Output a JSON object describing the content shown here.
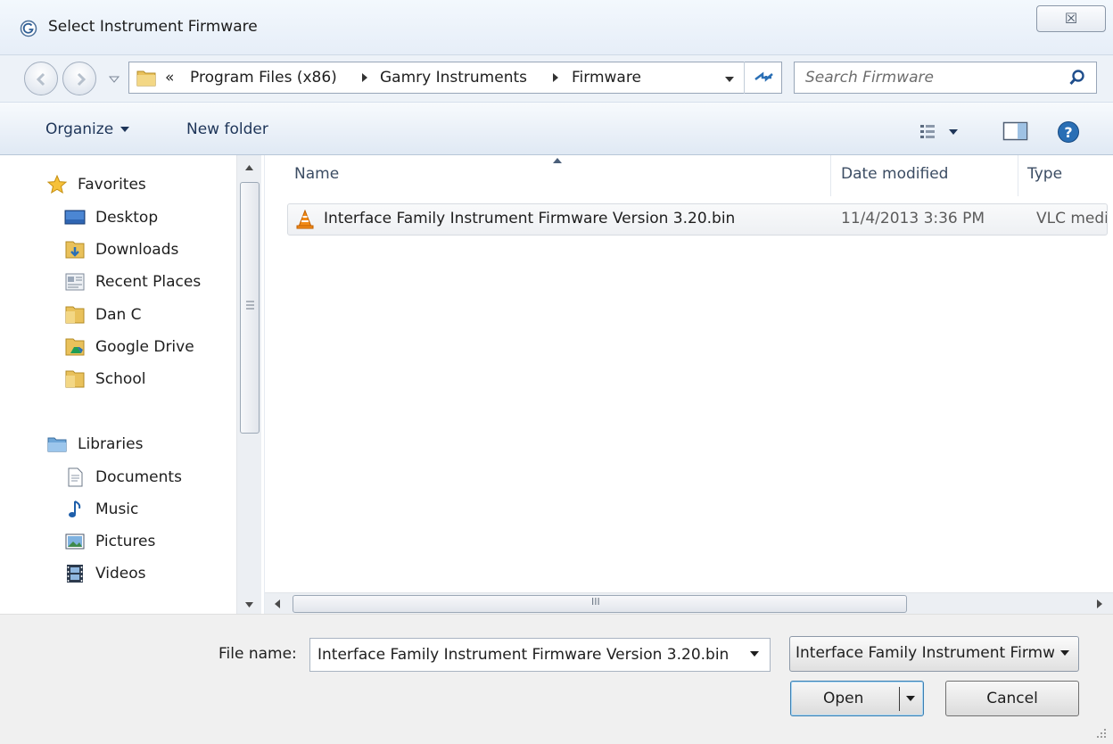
{
  "window": {
    "title": "Select Instrument Firmware",
    "close_glyph": "☒"
  },
  "address": {
    "overflow": "«",
    "crumbs": [
      "Program Files (x86)",
      "Gamry Instruments",
      "Firmware"
    ],
    "search_placeholder": "Search Firmware"
  },
  "toolbar": {
    "organize": "Organize",
    "new_folder": "New folder"
  },
  "nav": {
    "favorites": {
      "label": "Favorites",
      "items": [
        "Desktop",
        "Downloads",
        "Recent Places",
        "Dan C",
        "Google Drive",
        "School"
      ]
    },
    "libraries": {
      "label": "Libraries",
      "items": [
        "Documents",
        "Music",
        "Pictures",
        "Videos"
      ]
    }
  },
  "columns": {
    "name": "Name",
    "date": "Date modified",
    "type": "Type"
  },
  "files": [
    {
      "name": "Interface Family Instrument Firmware Version 3.20.bin",
      "date": "11/4/2013 3:36 PM",
      "type": "VLC media file"
    }
  ],
  "footer": {
    "file_name_label": "File name:",
    "file_name_value": "Interface Family Instrument Firmware Version 3.20.bin",
    "file_type_value": "Interface Family Instrument Firmware",
    "open_label": "Open",
    "cancel_label": "Cancel"
  },
  "scroll_glyph": "III",
  "colors": {
    "accent": "#2a6fb5",
    "toolbar_text": "#1e3559",
    "folder": "#e9c15b"
  }
}
